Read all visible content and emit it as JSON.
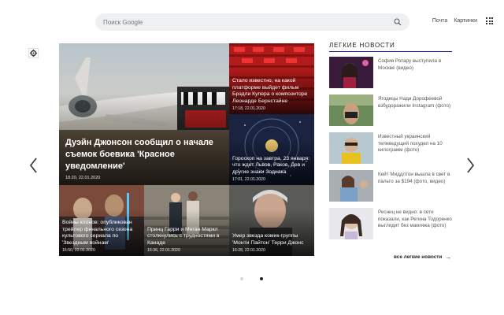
{
  "search": {
    "placeholder": "Поиск Google"
  },
  "toplinks": {
    "mail": "Почта",
    "images": "Картинки"
  },
  "tiles": [
    {
      "title": "Дуэйн Джонсон сообщил о начале съемок боевика 'Красное уведомление'",
      "date": "18:20, 22.01.2020"
    },
    {
      "title": "Стало известно, на какой платформе выйдет фильм Брэдли Купера о композиторе Леонарде Бернстайне",
      "date": "17:18, 22.01.2020"
    },
    {
      "title": "Гороскоп на завтра, 23 января: что ждет Львов, Раков, Дев и другие знаки Зодиака",
      "date": "17:01, 22.01.2020"
    },
    {
      "title": "Войны клонов: опубликован трейлер финального сезона культового сериала по 'Звездным войнам'",
      "date": "16:50, 22.01.2020"
    },
    {
      "title": "Принц Гарри и Меган Маркл столкнулись с трудностями в Канаде",
      "date": "16:36, 22.01.2020"
    },
    {
      "title": "Умер звезда комик-группы 'Монти Пайтон' Терри Джонс",
      "date": "16:28, 22.01.2020"
    }
  ],
  "light_news": {
    "heading": "ЛЕГКИЕ НОВОСТИ",
    "items": [
      {
        "text": "София Ротару выступила в Москве (видео)"
      },
      {
        "text": "Ягодицы Нади Дорофеевой взбудоражили Instagram (фото)"
      },
      {
        "text": "Известный украинский телеведущий похудел на 10 килограмм (фото)"
      },
      {
        "text": "Кейт Миддлтон вышла в свет в пальто за $194 (фото, видео)"
      },
      {
        "text": "Ресниц не видно: в сети показали, как Регина Тодоренко выглядит без макияжа (фото)"
      }
    ],
    "all_label": "все легкие новости"
  },
  "pagination": {
    "total": 2,
    "active": 2
  }
}
